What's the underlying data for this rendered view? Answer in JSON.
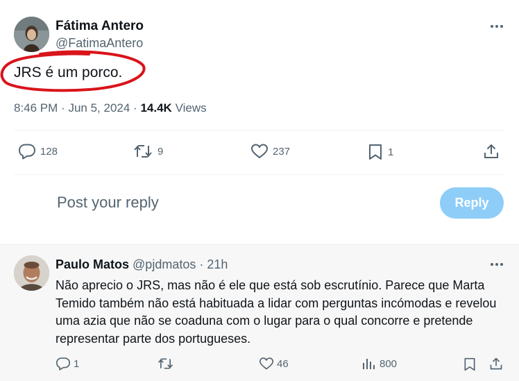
{
  "main_tweet": {
    "author_name": "Fátima Antero",
    "author_handle": "@FatimaAntero",
    "text": "JRS é um porco.",
    "time": "8:46 PM",
    "date": "Jun 5, 2024",
    "separator": "·",
    "views_count": "14.4K",
    "views_label": "Views",
    "actions": {
      "replies": "128",
      "reposts": "9",
      "likes": "237",
      "bookmarks": "1"
    }
  },
  "reply_box": {
    "placeholder": "Post your reply",
    "button_label": "Reply"
  },
  "reply_tweet": {
    "author_name": "Paulo Matos",
    "author_handle": "@pjdmatos",
    "separator": "·",
    "time": "21h",
    "text": "Não aprecio o JRS, mas não é ele que está sob escrutínio. Parece que Marta Temido também não está habituada a lidar com perguntas incómodas e revelou uma azia que não se coaduna com o lugar para o qual concorre e pretende representar parte dos portugueses.",
    "actions": {
      "replies": "1",
      "likes": "46",
      "views": "800"
    }
  },
  "colors": {
    "accent_disabled": "#8ecdf8",
    "secondary_text": "#536471",
    "annotation_circle": "#d9141b"
  },
  "icons": [
    "more-icon",
    "reply-icon",
    "repost-icon",
    "like-icon",
    "bookmark-icon",
    "share-icon",
    "views-icon"
  ]
}
